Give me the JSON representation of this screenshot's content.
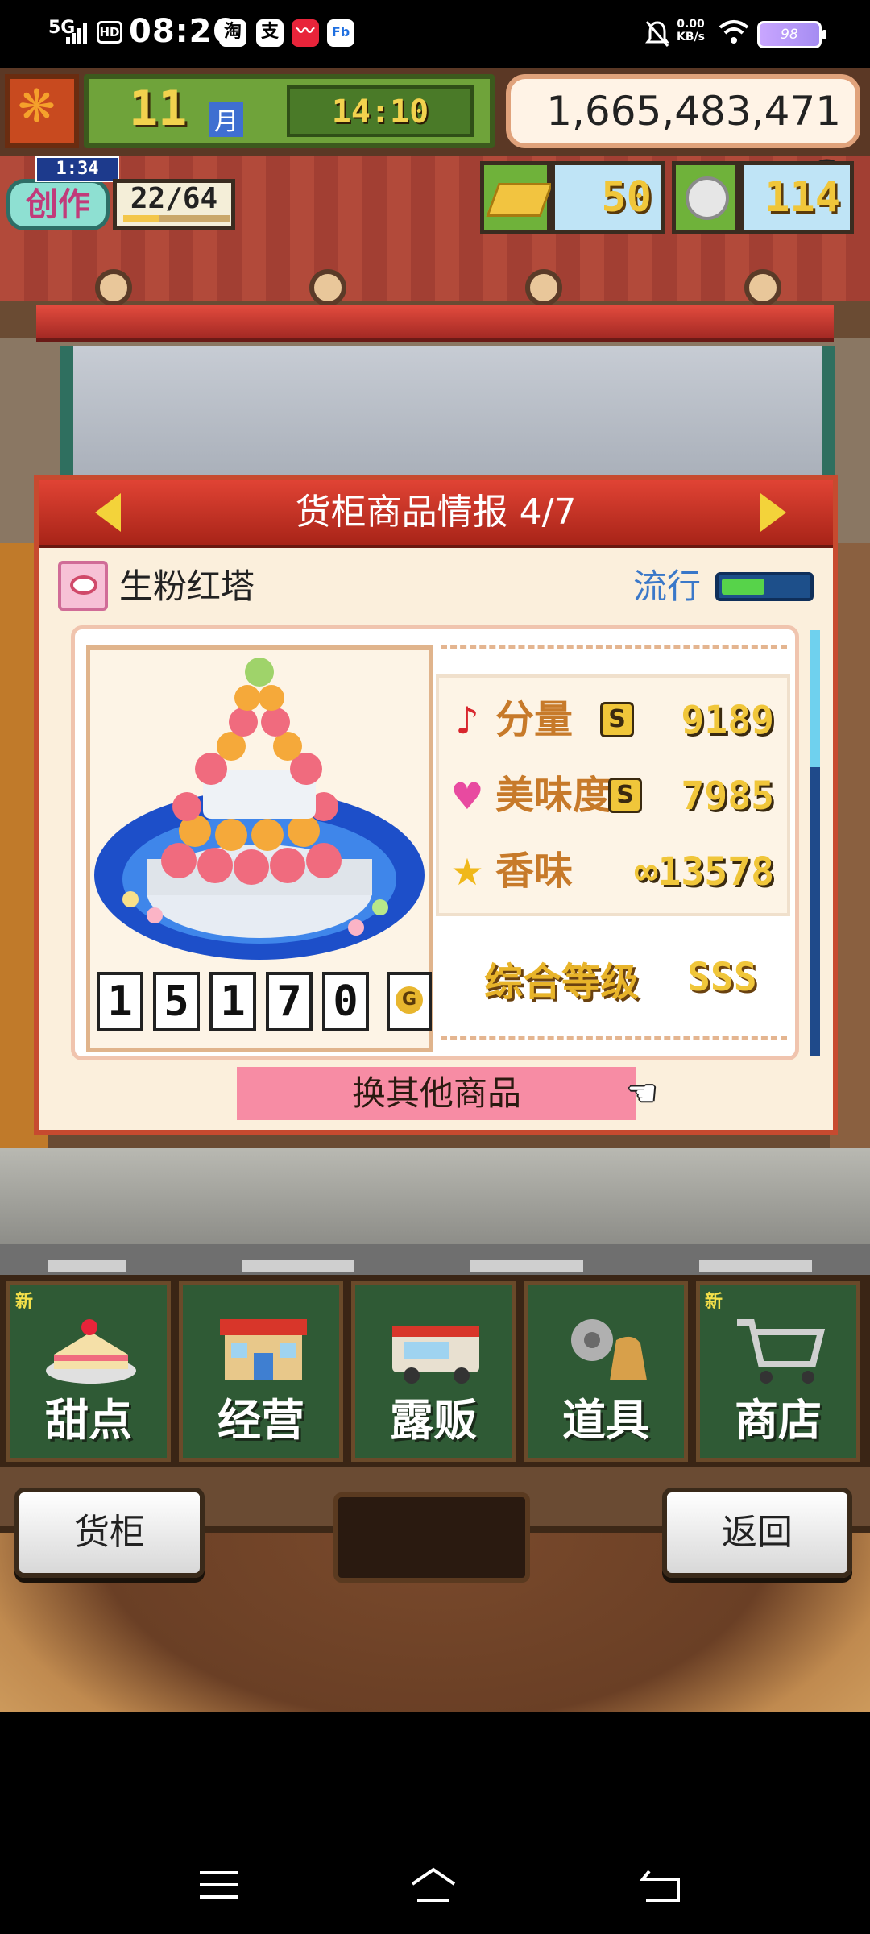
{
  "status_bar": {
    "network": "5G",
    "hd": "HD",
    "time": "08:26",
    "app_icons": [
      "淘",
      "支",
      "〰",
      "Fb"
    ],
    "net_speed_value": "0.00",
    "net_speed_unit": "KB/s",
    "battery": "98"
  },
  "hud": {
    "month": "11",
    "month_unit": "月",
    "clock": "14:10",
    "money": "1,665,483,471 G",
    "create_timer": "1:34",
    "create_label": "创作",
    "create_count": "22/64",
    "create_progress": 0.34,
    "gold_bars": "50",
    "coins": "114"
  },
  "modal": {
    "title": "货柜商品情报 4/7",
    "product_name": "生粉红塔",
    "trend_label": "流行",
    "trend_level": 0.5,
    "price_digits": [
      "1",
      "5",
      "1",
      "7",
      "0"
    ],
    "price_unit": "G",
    "stats": [
      {
        "label": "分量",
        "rank": "S",
        "value": "9189",
        "icon": "music-note-icon"
      },
      {
        "label": "美味度",
        "rank": "S",
        "value": "7985",
        "icon": "heart-icon"
      },
      {
        "label": "香味",
        "rank": "",
        "value": "∞13578",
        "icon": "star-icon"
      }
    ],
    "overall_label": "综合等级",
    "overall_value": "SSS",
    "switch_button": "换其他商品"
  },
  "categories": [
    {
      "label": "甜点",
      "new": "新"
    },
    {
      "label": "经营",
      "new": ""
    },
    {
      "label": "露贩",
      "new": ""
    },
    {
      "label": "道具",
      "new": ""
    },
    {
      "label": "商店",
      "new": "新"
    }
  ],
  "bottom": {
    "shelf_button": "货柜",
    "back_button": "返回"
  },
  "colors": {
    "modal_header": "#c8362a",
    "switch_button": "#f78ca4",
    "stat_number": "#f0c63a",
    "category_bg": "#2f5a35"
  }
}
